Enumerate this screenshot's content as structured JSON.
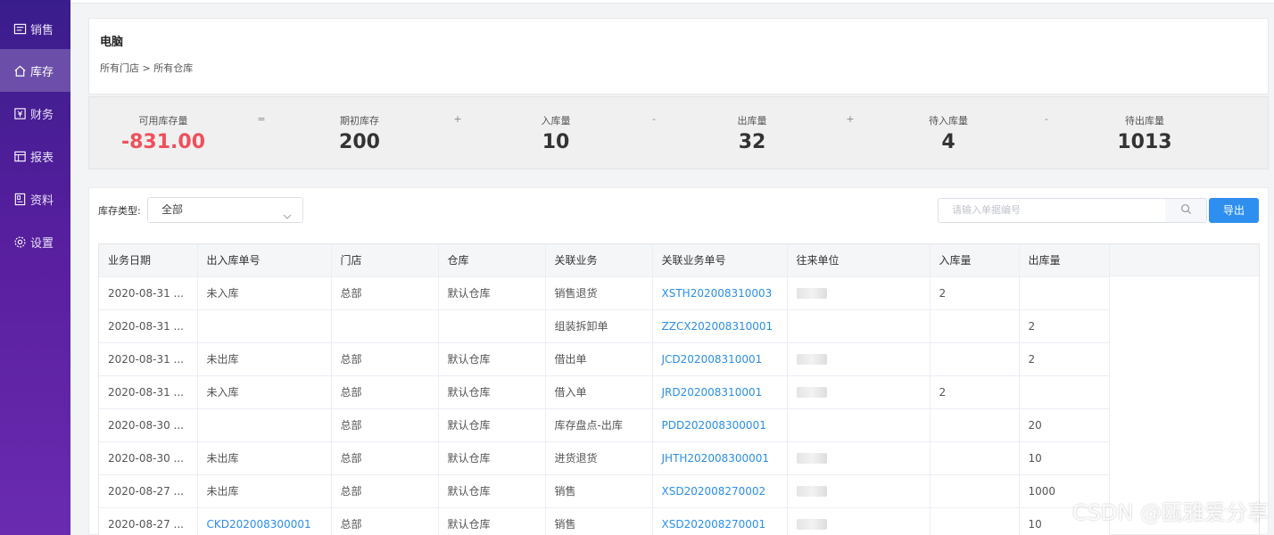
{
  "sidebar": {
    "items": [
      {
        "label": "销售",
        "icon": "sales-icon",
        "active": false
      },
      {
        "label": "库存",
        "icon": "home-icon",
        "active": true
      },
      {
        "label": "财务",
        "icon": "finance-icon",
        "active": false
      },
      {
        "label": "报表",
        "icon": "report-icon",
        "active": false
      },
      {
        "label": "资料",
        "icon": "archive-icon",
        "active": false
      },
      {
        "label": "设置",
        "icon": "gear-icon",
        "active": false
      }
    ]
  },
  "header": {
    "title": "电脑",
    "breadcrumb": "所有门店 > 所有仓库"
  },
  "summary": {
    "available": {
      "label": "可用库存量",
      "value": "-831.00"
    },
    "op1": "=",
    "opening": {
      "label": "期初库存",
      "value": "200"
    },
    "op2": "+",
    "inbound": {
      "label": "入库量",
      "value": "10"
    },
    "op3": "-",
    "outbound": {
      "label": "出库量",
      "value": "32"
    },
    "op4": "+",
    "pending_in": {
      "label": "待入库量",
      "value": "4"
    },
    "op5": "-",
    "pending_out": {
      "label": "待出库量",
      "value": "1013"
    }
  },
  "filter": {
    "label": "库存类型:",
    "selected": "全部",
    "search_placeholder": "请输入单据编号",
    "export_label": "导出"
  },
  "table": {
    "columns": [
      "业务日期",
      "出入库单号",
      "门店",
      "仓库",
      "关联业务",
      "关联业务单号",
      "往来单位",
      "入库量",
      "出库量"
    ],
    "rows": [
      [
        "2020-08-31 ...",
        "未入库",
        "总部",
        "默认仓库",
        "销售退货",
        "XSTH202008310003",
        "",
        "2",
        ""
      ],
      [
        "2020-08-31 ...",
        "",
        "",
        "",
        "组装拆卸单",
        "ZZCX202008310001",
        "",
        "",
        "2"
      ],
      [
        "2020-08-31 ...",
        "未出库",
        "总部",
        "默认仓库",
        "借出单",
        "JCD202008310001",
        "",
        "",
        "2"
      ],
      [
        "2020-08-31 ...",
        "未入库",
        "总部",
        "默认仓库",
        "借入单",
        "JRD202008310001",
        "",
        "2",
        ""
      ],
      [
        "2020-08-30 ...",
        "",
        "总部",
        "默认仓库",
        "库存盘点-出库",
        "PDD202008300001",
        "",
        "",
        "20"
      ],
      [
        "2020-08-30 ...",
        "未出库",
        "总部",
        "默认仓库",
        "进货退货",
        "JHTH202008300001",
        "",
        "",
        "10"
      ],
      [
        "2020-08-27 ...",
        "未出库",
        "总部",
        "默认仓库",
        "销售",
        "XSD202008270002",
        "",
        "",
        "1000"
      ],
      [
        "2020-08-27 ...",
        "CKD202008300001",
        "总部",
        "默认仓库",
        "销售",
        "XSD202008270001",
        "",
        "",
        "10"
      ]
    ]
  },
  "watermark": "CSDN @瓯雅爱分享",
  "colors": {
    "negative": "#f0505b",
    "link": "#2b8ee8",
    "primary_button": "#2f8ff0"
  }
}
